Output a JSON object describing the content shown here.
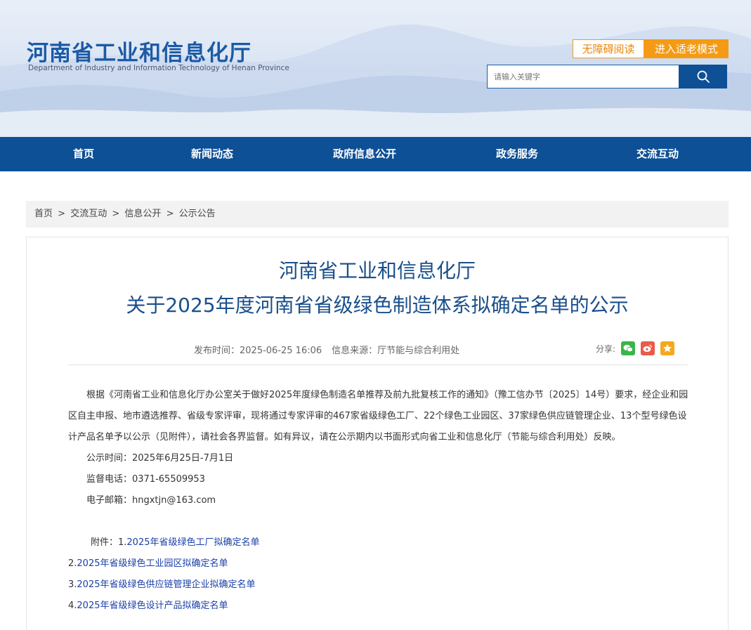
{
  "header": {
    "title_cn": "河南省工业和信息化厅",
    "title_en": "Department of Industry and Information Technology of Henan Province",
    "accessibility_label": "无障碍阅读",
    "elder_mode_label": "进入适老模式",
    "search_placeholder": "请输入关键字"
  },
  "nav": {
    "items": [
      "首页",
      "新闻动态",
      "政府信息公开",
      "政务服务",
      "交流互动"
    ]
  },
  "breadcrumb": [
    "首页",
    "交流互动",
    "信息公开",
    "公示公告"
  ],
  "breadcrumb_sep": ">",
  "article": {
    "title_line1": "河南省工业和信息化厅",
    "title_line2": "关于2025年度河南省省级绿色制造体系拟确定名单的公示",
    "publish_time": "发布时间：2025-06-25 16:06",
    "source": "信息来源：厅节能与综合利用处",
    "share_label": "分享:",
    "paragraph": "根据《河南省工业和信息化厅办公室关于做好2025年度绿色制造名单推荐及前九批复核工作的通知》（豫工信办节〔2025〕14号）要求，经企业和园区自主申报、地市遴选推荐、省级专家评审，现将通过专家评审的467家省级绿色工厂、22个绿色工业园区、37家绿色供应链管理企业、13个型号绿色设计产品名单予以公示（见附件），请社会各界监督。如有异议，请在公示期内以书面形式向省工业和信息化厅（节能与综合利用处）反映。",
    "notice_period": "公示时间：2025年6月25日-7月1日",
    "phone": "监督电话：0371-65509953",
    "email": "电子邮箱：hngxtjn@163.com",
    "attachment_label": "附件：1.",
    "attachments": [
      {
        "num": "",
        "text": "2025年省级绿色工厂拟确定名单"
      },
      {
        "num": "2.",
        "text": "2025年省级绿色工业园区拟确定名单"
      },
      {
        "num": "3.",
        "text": "2025年省级绿色供应链管理企业拟确定名单"
      },
      {
        "num": "4.",
        "text": "2025年省级绿色设计产品拟确定名单"
      }
    ]
  },
  "colors": {
    "brand_blue": "#0e5096",
    "title_blue": "#1a4f8b",
    "orange": "#f59a14",
    "link_blue": "#1a3fa8",
    "wechat_green": "#3bb54a",
    "weibo_red": "#e85b4a",
    "favorite_orange": "#f2a91d"
  }
}
